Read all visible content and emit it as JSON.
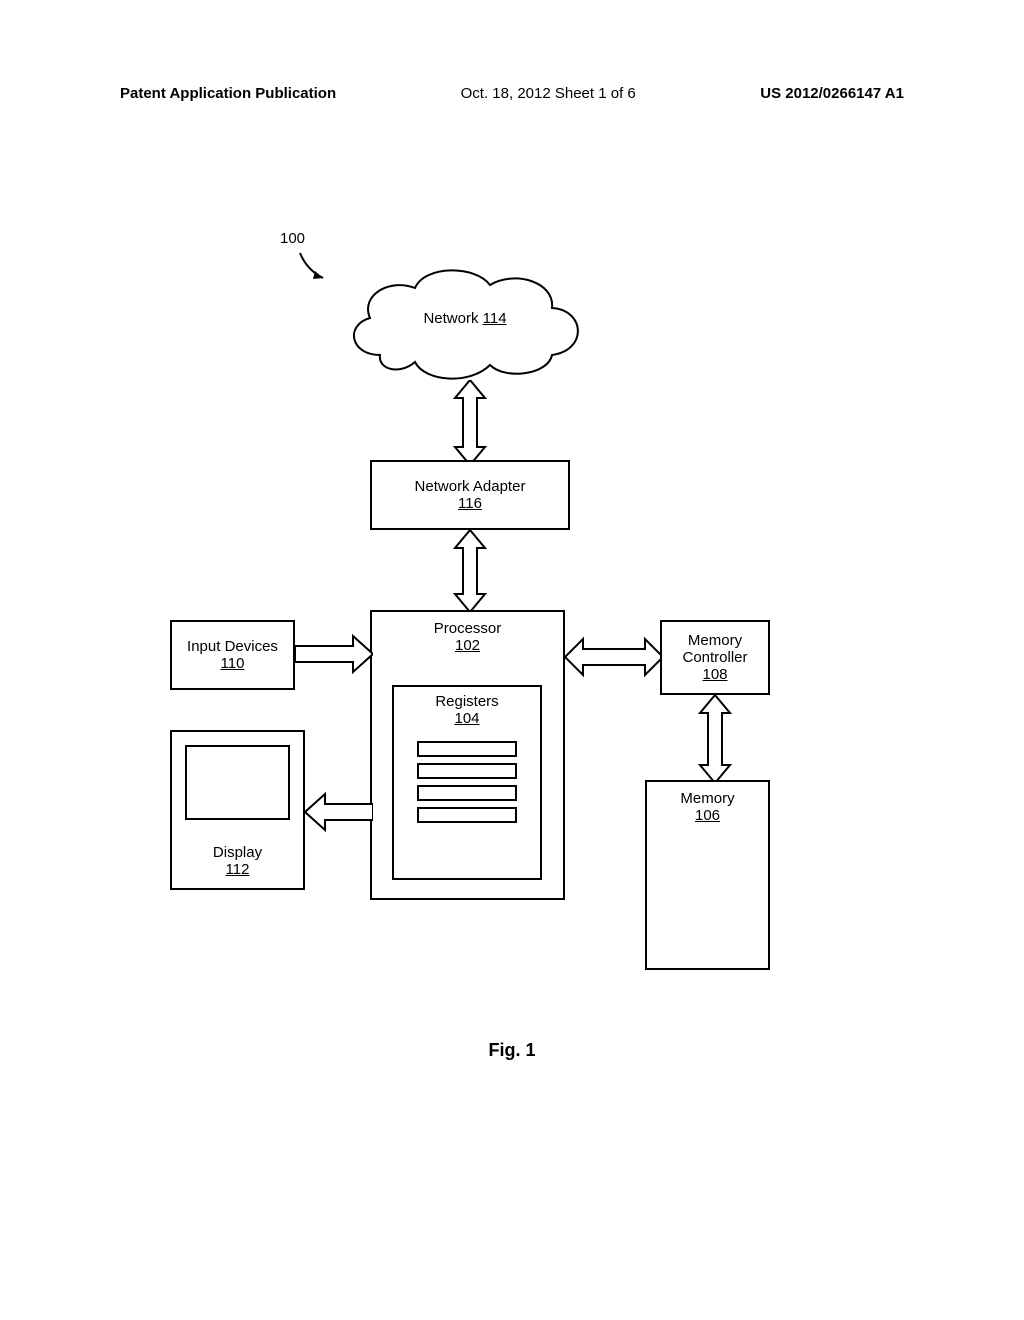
{
  "header": {
    "left": "Patent Application Publication",
    "mid": "Oct. 18, 2012  Sheet 1 of 6",
    "right": "US 2012/0266147 A1"
  },
  "ref": {
    "number": "100"
  },
  "blocks": {
    "network": {
      "label": "Network",
      "num": "114"
    },
    "net_adapter": {
      "label": "Network Adapter",
      "num": "116"
    },
    "processor": {
      "label": "Processor",
      "num": "102"
    },
    "registers": {
      "label": "Registers",
      "num": "104"
    },
    "input_devices": {
      "label": "Input Devices",
      "num": "110"
    },
    "display": {
      "label": "Display",
      "num": "112"
    },
    "mem_ctrl": {
      "label_line1": "Memory",
      "label_line2": "Controller",
      "num": "108"
    },
    "memory": {
      "label": "Memory",
      "num": "106"
    }
  },
  "figure": {
    "label": "Fig. 1"
  }
}
